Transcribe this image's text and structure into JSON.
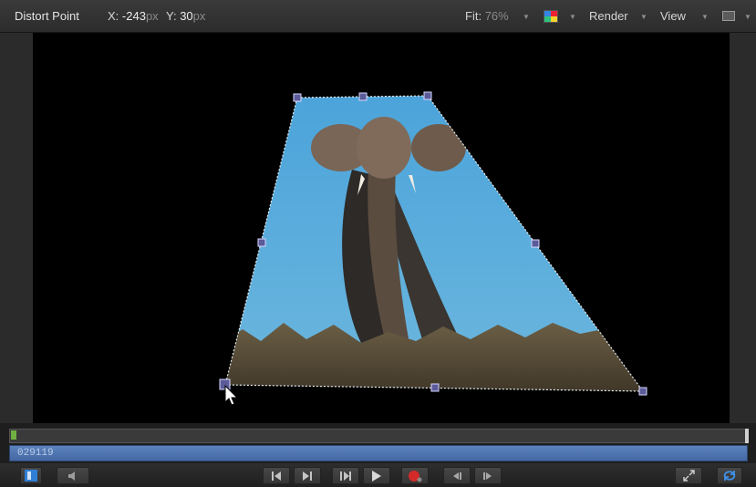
{
  "toolbar": {
    "tool_name": "Distort Point",
    "x_label": "X:",
    "x_value": "-243",
    "x_unit": "px",
    "y_label": "Y:",
    "y_value": "30",
    "y_unit": "px",
    "fit_label": "Fit:",
    "fit_value": "76%",
    "render_label": "Render",
    "view_label": "View",
    "icons": [
      "chevron-down-icon",
      "color-channels-icon",
      "layout-icon"
    ]
  },
  "timeline": {
    "timecode": "029119"
  },
  "transport": {
    "icons": [
      "layout-toggle-icon",
      "mute-icon",
      "go-to-start-icon",
      "step-back-icon",
      "step-forward-icon",
      "play-icon",
      "record-icon",
      "audio-scrub-back-icon",
      "audio-scrub-forward-icon",
      "fullscreen-icon",
      "loop-icon"
    ]
  },
  "colors": {
    "sky": "#52a6d9",
    "timebar": "#4d72ad",
    "accent_blue": "#2f7fd6",
    "record_red": "#d42a2a"
  }
}
